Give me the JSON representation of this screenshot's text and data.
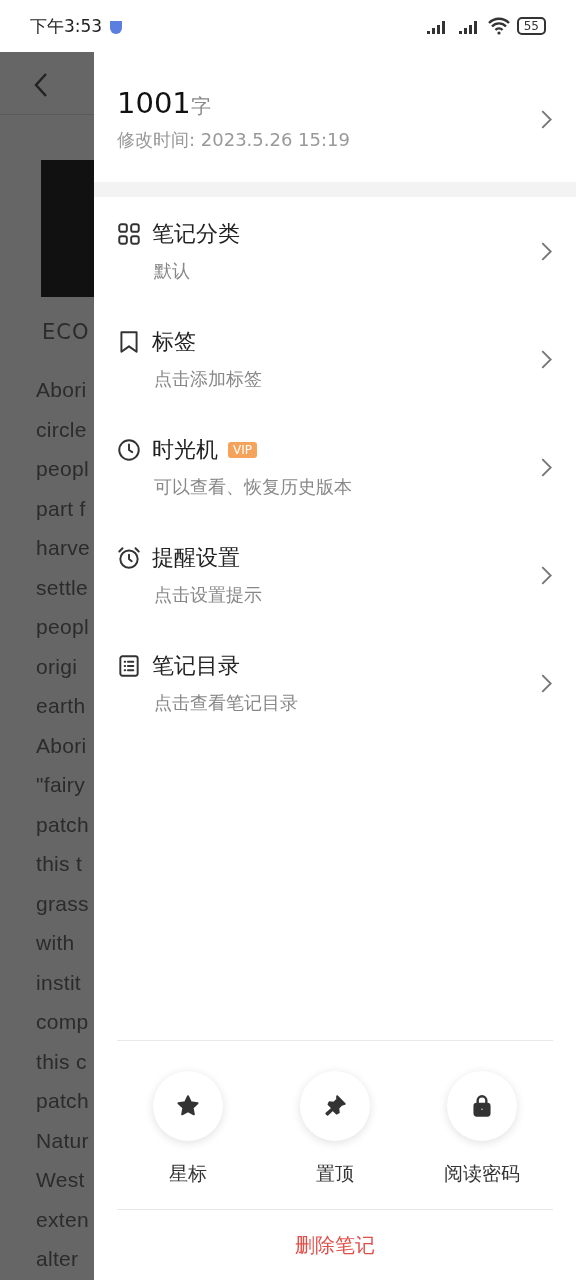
{
  "status_bar": {
    "time": "下午3:53",
    "battery": "55"
  },
  "article": {
    "section": "ECO",
    "lines": [
      "Abori",
      "circle",
      "peopl",
      "part f",
      "harve",
      "settle",
      "peopl",
      "origi",
      "earth",
      "Abori",
      "\"fairy",
      "patch",
      "this t",
      "grass",
      "with",
      "instit",
      "comp",
      "this c",
      "patch",
      "Natur",
      "West",
      "exten",
      "alter"
    ]
  },
  "drawer": {
    "count": "1001",
    "count_unit": "字",
    "modified": "修改时间: 2023.5.26 15:19",
    "items": [
      {
        "title": "笔记分类",
        "subtitle": "默认"
      },
      {
        "title": "标签",
        "subtitle": "点击添加标签"
      },
      {
        "title": "时光机",
        "badge": "VIP",
        "subtitle": "可以查看、恢复历史版本"
      },
      {
        "title": "提醒设置",
        "subtitle": "点击设置提示"
      },
      {
        "title": "笔记目录",
        "subtitle": "点击查看笔记目录"
      }
    ],
    "actions": [
      {
        "label": "星标"
      },
      {
        "label": "置顶"
      },
      {
        "label": "阅读密码"
      }
    ],
    "delete": "删除笔记"
  }
}
